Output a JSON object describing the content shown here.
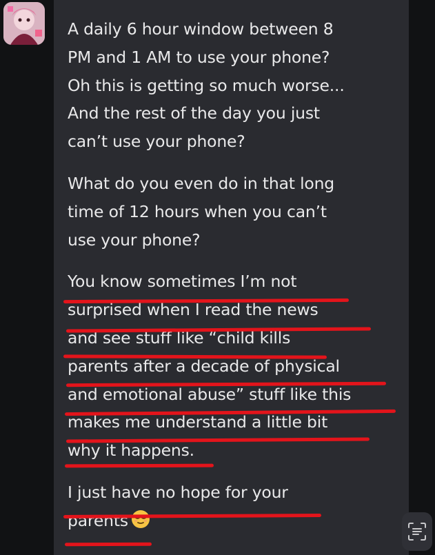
{
  "message": {
    "paragraphs": [
      {
        "lines": [
          "A daily 6 hour window between 8",
          "PM and 1 AM to use your phone?",
          "Oh this is getting so much worse...",
          "And the rest of the day you just",
          "can’t use your phone?"
        ]
      },
      {
        "lines": [
          "What do you even do in that long",
          "time of 12 hours when you can’t",
          "use your phone?"
        ]
      },
      {
        "lines": [
          "You know sometimes I’m not",
          "surprised when I read the news",
          "and see stuff like “child kills",
          "parents after a decade of physical",
          "and emotional abuse” stuff like this",
          "makes me understand a little bit",
          "why it happens."
        ]
      },
      {
        "lines": [
          "I just have no hope for your",
          "parents"
        ]
      }
    ],
    "emoji": "relieved-face-icon"
  },
  "colors": {
    "bubble": "#2a2b30",
    "text": "#e9e9ea",
    "underline": "#e3141b",
    "background": "#111214"
  }
}
